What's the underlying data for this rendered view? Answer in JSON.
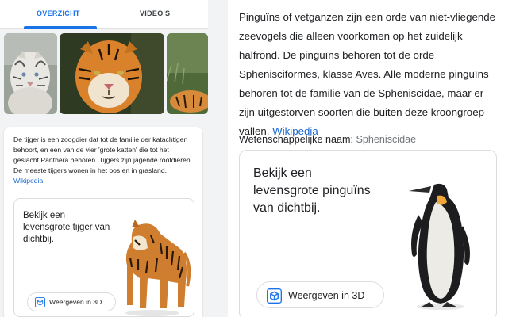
{
  "left": {
    "tabs": [
      {
        "label": "OVERZICHT",
        "selected": true
      },
      {
        "label": "VIDEO'S",
        "selected": false
      }
    ],
    "images": [
      "white-tiger-photo",
      "tiger-face-photo",
      "tiger-in-grass-photo"
    ],
    "description": "De tijger is een zoogdier dat tot de familie der katachtigen behoort, en een van de vier 'grote katten' die tot het geslacht Panthera behoren. Tijgers zijn jagende roofdieren. De meeste tijgers wonen in het bos en in grasland.",
    "source_link": "Wikipedia",
    "ar_card": {
      "text": "Bekijk een levensgrote tijger van dichtbij.",
      "button_label": "Weergeven in 3D",
      "model": "tiger-3d-model"
    }
  },
  "right": {
    "description": "Pinguïns of vetganzen zijn een orde van niet-vliegende zeevogels die alleen voorkomen op het zuidelijk halfrond. De pinguïns behoren tot de orde Sphenisciformes, klasse Aves. Alle moderne pinguïns behoren tot de familie van de Spheniscidae, maar er zijn uitgestorven soorten die buiten deze kroongroep vallen.",
    "source_link": "Wikipedia",
    "scientific_name_label": "Wetenschappelijke naam:",
    "scientific_name_value": "Spheniscidae",
    "ar_card": {
      "text": "Bekijk een levensgrote pinguïns van dichtbij.",
      "button_label": "Weergeven in 3D",
      "model": "penguin-3d-model"
    }
  },
  "colors": {
    "accent": "#1a73e8",
    "link": "#1967d2",
    "border": "#dadce0",
    "muted": "#70757a"
  }
}
